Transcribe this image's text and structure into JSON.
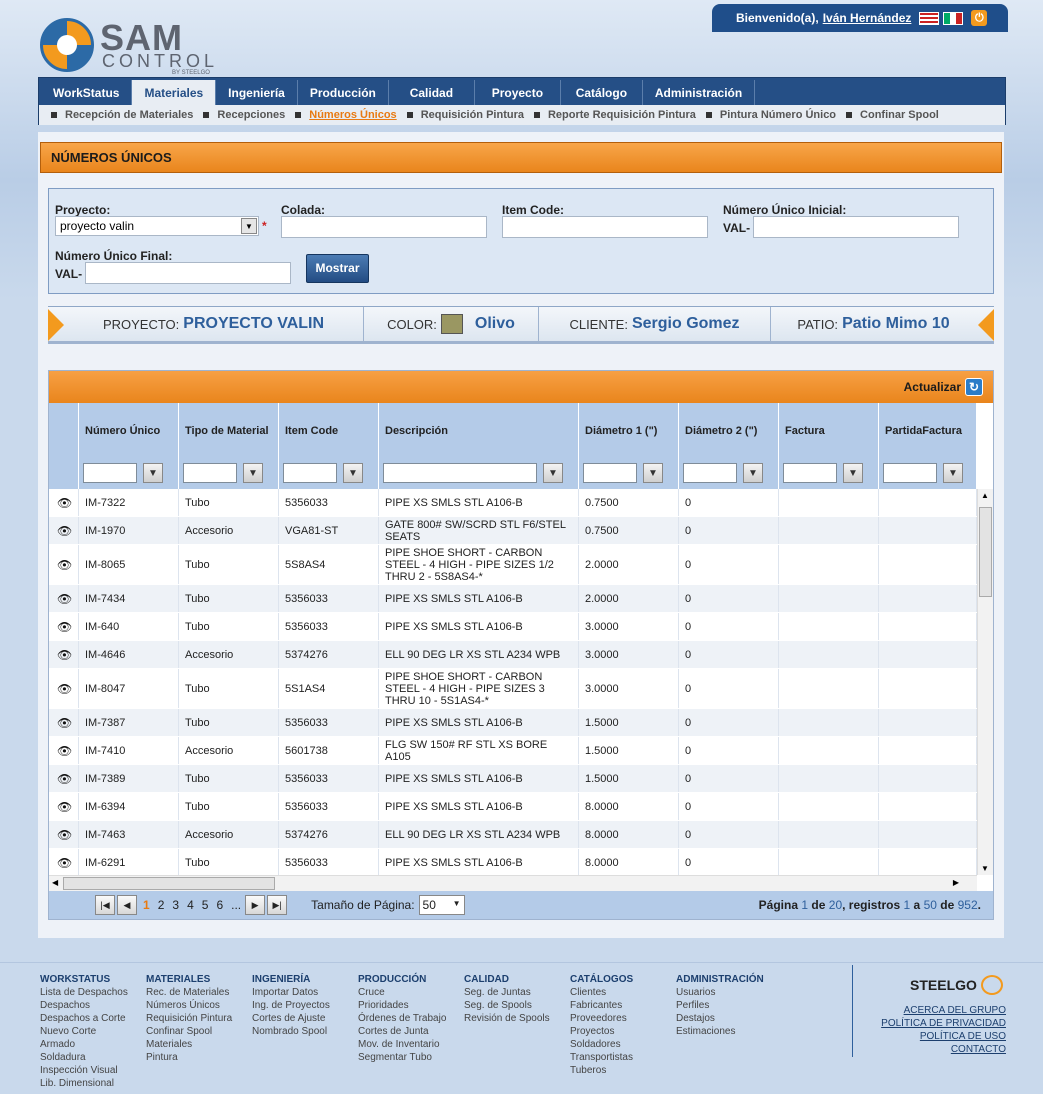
{
  "header": {
    "welcome": "Bienvenido(a),",
    "user": "Iván Hernández",
    "logo_line1": "SAM",
    "logo_line2": "CONTROL",
    "logo_line3": "BY STEELGO"
  },
  "nav": [
    "WorkStatus",
    "Materiales",
    "Ingeniería",
    "Producción",
    "Calidad",
    "Proyecto",
    "Catálogo",
    "Administración"
  ],
  "subnav": [
    "Recepción de Materiales",
    "Recepciones",
    "Números Únicos",
    "Requisición Pintura",
    "Reporte Requisición Pintura",
    "Pintura Número Único",
    "Confinar Spool"
  ],
  "page_title": "NÚMEROS ÚNICOS",
  "filters": {
    "proyecto_label": "Proyecto:",
    "proyecto_value": "proyecto valin",
    "colada_label": "Colada:",
    "itemcode_label": "Item Code:",
    "nu_inicial_label": "Número Único Inicial:",
    "nu_final_label": "Número Único Final:",
    "val_prefix": "VAL-",
    "required": "*",
    "mostrar": "Mostrar"
  },
  "info": {
    "proyecto_label": "PROYECTO:",
    "proyecto": "PROYECTO VALIN",
    "color_label": "COLOR:",
    "color": "Olivo",
    "color_hex": "#9a9762",
    "cliente_label": "CLIENTE:",
    "cliente": "Sergio Gomez",
    "patio_label": "PATIO:",
    "patio": "Patio Mimo 10"
  },
  "grid": {
    "actualizar": "Actualizar",
    "columns": [
      "Número Único",
      "Tipo de Material",
      "Item Code",
      "Descripción",
      "Diámetro 1 (\")",
      "Diámetro 2 (\")",
      "Factura",
      "PartidaFactura"
    ],
    "rows": [
      {
        "nu": "IM-7322",
        "tipo": "Tubo",
        "item": "5356033",
        "desc": "PIPE XS SMLS STL A106-B",
        "d1": "0.7500",
        "d2": "0"
      },
      {
        "nu": "IM-1970",
        "tipo": "Accesorio",
        "item": "VGA81-ST",
        "desc": "GATE 800# SW/SCRD STL F6/STEL SEATS",
        "d1": "0.7500",
        "d2": "0"
      },
      {
        "nu": "IM-8065",
        "tipo": "Tubo",
        "item": "5S8AS4",
        "desc": "PIPE SHOE SHORT - CARBON STEEL - 4 HIGH - PIPE SIZES 1/2 THRU 2 - 5S8AS4-*",
        "d1": "2.0000",
        "d2": "0"
      },
      {
        "nu": "IM-7434",
        "tipo": "Tubo",
        "item": "5356033",
        "desc": "PIPE XS SMLS STL A106-B",
        "d1": "2.0000",
        "d2": "0"
      },
      {
        "nu": "IM-640",
        "tipo": "Tubo",
        "item": "5356033",
        "desc": "PIPE XS SMLS STL A106-B",
        "d1": "3.0000",
        "d2": "0"
      },
      {
        "nu": "IM-4646",
        "tipo": "Accesorio",
        "item": "5374276",
        "desc": "ELL 90 DEG LR XS STL A234 WPB",
        "d1": "3.0000",
        "d2": "0"
      },
      {
        "nu": "IM-8047",
        "tipo": "Tubo",
        "item": "5S1AS4",
        "desc": "PIPE SHOE SHORT - CARBON STEEL - 4 HIGH - PIPE SIZES 3 THRU 10 - 5S1AS4-*",
        "d1": "3.0000",
        "d2": "0"
      },
      {
        "nu": "IM-7387",
        "tipo": "Tubo",
        "item": "5356033",
        "desc": "PIPE XS SMLS STL A106-B",
        "d1": "1.5000",
        "d2": "0"
      },
      {
        "nu": "IM-7410",
        "tipo": "Accesorio",
        "item": "5601738",
        "desc": "FLG SW 150# RF STL XS BORE A105",
        "d1": "1.5000",
        "d2": "0"
      },
      {
        "nu": "IM-7389",
        "tipo": "Tubo",
        "item": "5356033",
        "desc": "PIPE XS SMLS STL A106-B",
        "d1": "1.5000",
        "d2": "0"
      },
      {
        "nu": "IM-6394",
        "tipo": "Tubo",
        "item": "5356033",
        "desc": "PIPE XS SMLS STL A106-B",
        "d1": "8.0000",
        "d2": "0"
      },
      {
        "nu": "IM-7463",
        "tipo": "Accesorio",
        "item": "5374276",
        "desc": "ELL 90 DEG LR XS STL A234 WPB",
        "d1": "8.0000",
        "d2": "0"
      },
      {
        "nu": "IM-6291",
        "tipo": "Tubo",
        "item": "5356033",
        "desc": "PIPE XS SMLS STL A106-B",
        "d1": "8.0000",
        "d2": "0"
      }
    ]
  },
  "pager": {
    "pages": [
      "1",
      "2",
      "3",
      "4",
      "5",
      "6",
      "..."
    ],
    "current": "1",
    "size_label": "Tamaño de Página:",
    "size": "50",
    "info_pagina": "Página",
    "page": "1",
    "de": "de",
    "total_pages": "20",
    "registros": ", registros",
    "from": "1",
    "a": "a",
    "to": "50",
    "total": "952",
    "dot": "."
  },
  "footer": {
    "cols": [
      {
        "title": "WORKSTATUS",
        "items": [
          "Lista de Despachos",
          "Despachos",
          "Despachos a Corte",
          "Nuevo Corte",
          "Armado",
          "Soldadura",
          "Inspección Visual",
          "Lib. Dimensional"
        ]
      },
      {
        "title": "MATERIALES",
        "items": [
          "Rec. de Materiales",
          "Números Únicos",
          "Requisición Pintura",
          "Confinar Spool",
          "Materiales",
          "Pintura"
        ]
      },
      {
        "title": "INGENIERÍA",
        "items": [
          "Importar Datos",
          "Ing. de Proyectos",
          "Cortes de Ajuste",
          "Nombrado Spool"
        ]
      },
      {
        "title": "PRODUCCIÓN",
        "items": [
          "Cruce",
          "Prioridades",
          "Órdenes de Trabajo",
          "Cortes de Junta",
          "Mov. de Inventario",
          "Segmentar Tubo"
        ]
      },
      {
        "title": "CALIDAD",
        "items": [
          "Seg. de Juntas",
          "Seg. de Spools",
          "Revisión de Spools"
        ]
      },
      {
        "title": "CATÁLOGOS",
        "items": [
          "Clientes",
          "Fabricantes",
          "Proveedores",
          "Proyectos",
          "Soldadores",
          "Transportistas",
          "Tuberos"
        ]
      },
      {
        "title": "ADMINISTRACIÓN",
        "items": [
          "Usuarios",
          "Perfiles",
          "Destajos",
          "Estimaciones"
        ]
      }
    ],
    "brand": "STEELGO",
    "links": [
      "ACERCA DEL GRUPO",
      "POLÍTICA DE PRIVACIDAD",
      "POLÍTICA DE USO",
      "CONTACTO"
    ]
  }
}
